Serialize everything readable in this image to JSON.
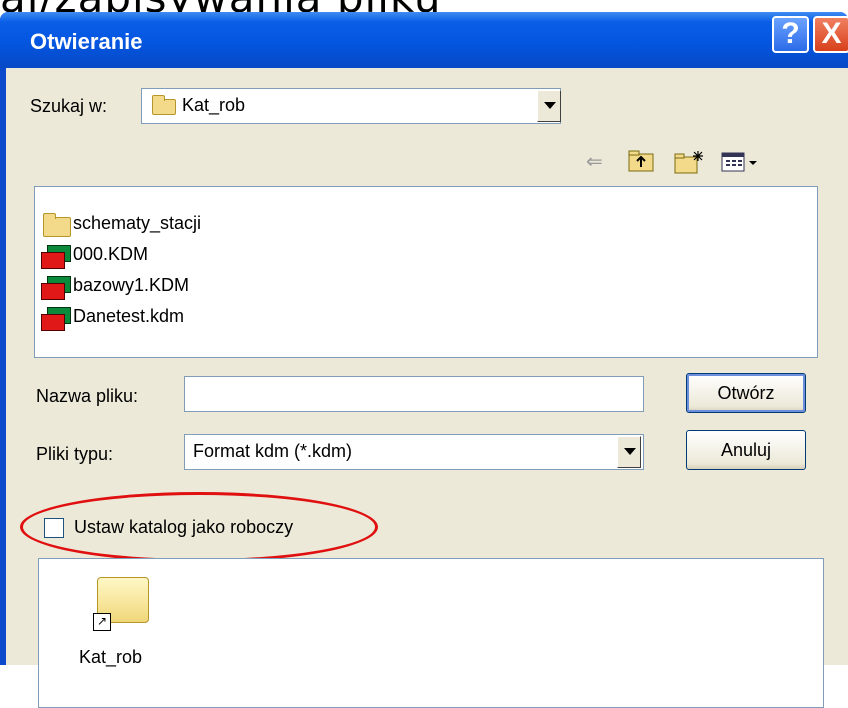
{
  "background_text": "aj/zapisywania pliku",
  "dialog": {
    "title": "Otwieranie",
    "help_glyph": "?",
    "close_glyph": "X"
  },
  "look_in": {
    "label": "Szukaj w:",
    "value": "Kat_rob"
  },
  "toolbar": {
    "icons": [
      "back-arrow-icon",
      "up-folder-icon",
      "new-folder-icon",
      "view-menu-icon"
    ]
  },
  "files": [
    {
      "name": "schematy_stacji",
      "icon": "folder-icon"
    },
    {
      "name": "000.KDM",
      "icon": "kdm-file-icon"
    },
    {
      "name": "bazowy1.KDM",
      "icon": "kdm-file-icon"
    },
    {
      "name": "Danetest.kdm",
      "icon": "kdm-file-icon"
    }
  ],
  "filename": {
    "label": "Nazwa pliku:",
    "value": ""
  },
  "filetype": {
    "label": "Pliki typu:",
    "value": "Format kdm (*.kdm)"
  },
  "buttons": {
    "open": "Otwórz",
    "cancel": "Anuluj"
  },
  "set_working_dir": {
    "label": "Ustaw katalog jako roboczy",
    "checked": false
  },
  "preview": {
    "item_label": "Kat_rob"
  },
  "colors": {
    "title_bar": "#0456e0",
    "dialog_face": "#ece9d8",
    "highlight_ellipse": "#e01010"
  }
}
